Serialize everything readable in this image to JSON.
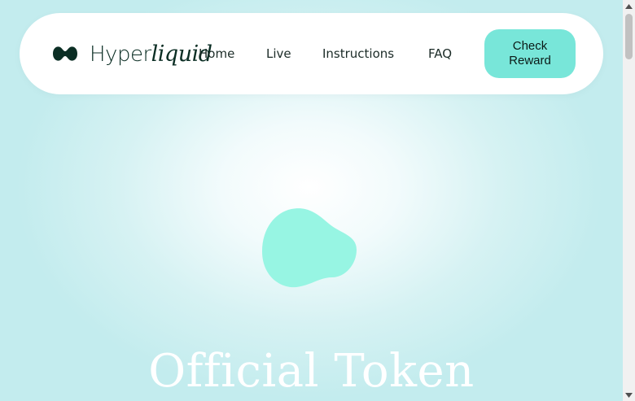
{
  "header": {
    "logo": {
      "icon": "hyperliquid-logo-icon",
      "text_regular": "Hyper",
      "text_italic": "liquid",
      "color": "#0b2e24"
    },
    "nav": [
      {
        "label": "Home"
      },
      {
        "label": "Live"
      },
      {
        "label": "Instructions"
      },
      {
        "label": "FAQ"
      }
    ],
    "cta": {
      "label": "Check Reward",
      "color": "#78e6d9"
    }
  },
  "hero": {
    "blob_color": "#97f5e3",
    "title": "Official Token"
  },
  "scrollbar": {
    "up_icon": "scroll-up-arrow-icon",
    "down_icon": "scroll-down-arrow-icon"
  }
}
